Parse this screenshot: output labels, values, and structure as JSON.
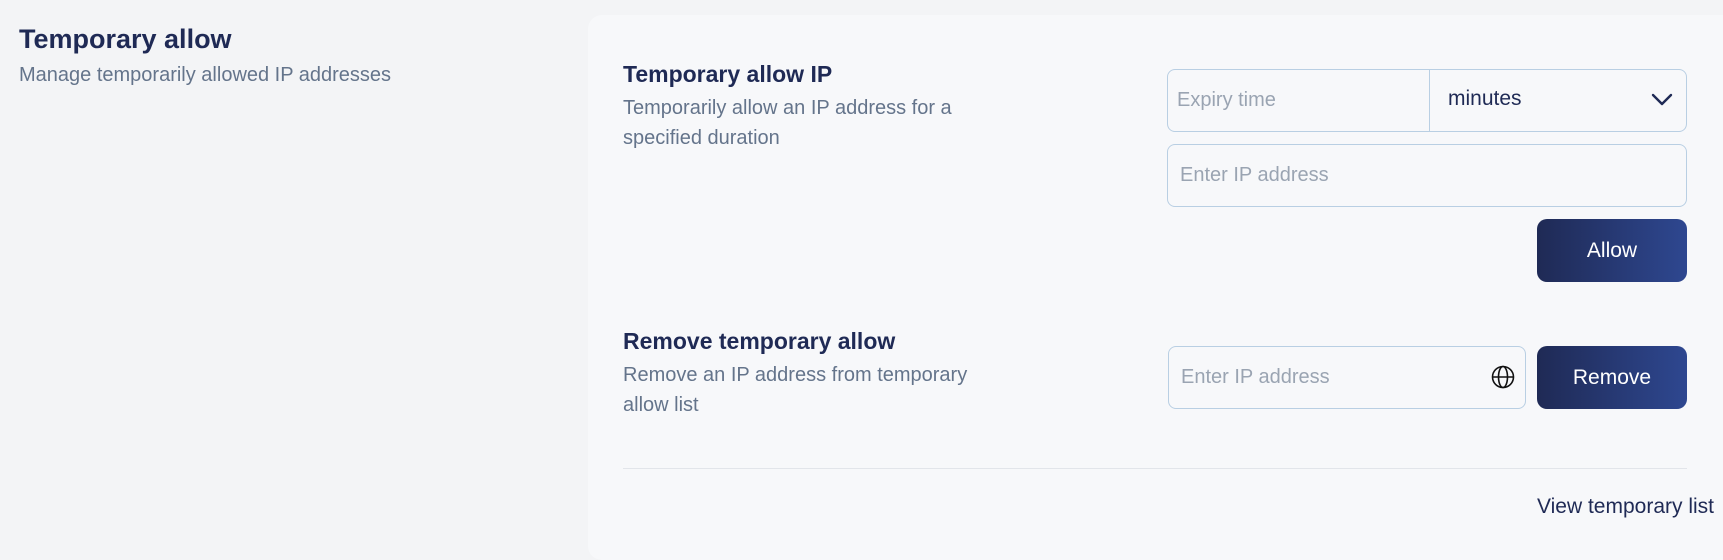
{
  "sidebar": {
    "title": "Temporary allow",
    "subtitle": "Manage temporarily allowed IP addresses"
  },
  "allow_section": {
    "title": "Temporary allow IP",
    "description": "Temporarily allow an IP address for a specified duration",
    "expiry_placeholder": "Expiry time",
    "unit_value": "minutes",
    "ip_placeholder": "Enter IP address",
    "button_label": "Allow"
  },
  "remove_section": {
    "title": "Remove temporary allow",
    "description": "Remove an IP address from temporary allow list",
    "ip_placeholder": "Enter IP address",
    "button_label": "Remove"
  },
  "footer": {
    "link_label": "View temporary list"
  },
  "colors": {
    "primary": "#1f2a55",
    "accent_gradient_end": "#2e4790",
    "muted_text": "#64748b",
    "border": "#b9cfe3"
  },
  "icons": {
    "dropdown": "chevron-down-icon",
    "ip": "globe-icon"
  }
}
